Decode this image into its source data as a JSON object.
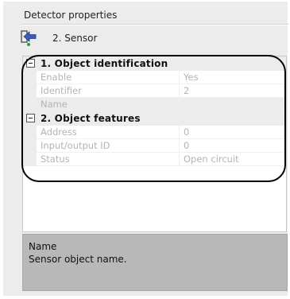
{
  "panel": {
    "title": "Detector properties"
  },
  "object": {
    "icon": "sensor-exit-icon",
    "label": "2. Sensor"
  },
  "grid": {
    "categories": [
      {
        "label": "1. Object identification",
        "expanded": true,
        "rows": [
          {
            "key": "Enable",
            "value": "Yes"
          },
          {
            "key": "Identifier",
            "value": "2"
          },
          {
            "key": "Name",
            "value": ""
          }
        ]
      },
      {
        "label": "2. Object features",
        "expanded": true,
        "rows": [
          {
            "key": "Address",
            "value": "0"
          },
          {
            "key": "Input/output ID",
            "value": "0"
          },
          {
            "key": "Status",
            "value": "Open circuit"
          }
        ]
      }
    ]
  },
  "description": {
    "title": "Name",
    "text": "Sensor object name."
  },
  "colors": {
    "panel_bg": "#ececec",
    "grid_bg": "#ffffff",
    "disabled_text": "#b4b4b4",
    "description_bg": "#b8b8b8",
    "icon_green": "#2aa02a",
    "icon_blue": "#3b5db8"
  }
}
